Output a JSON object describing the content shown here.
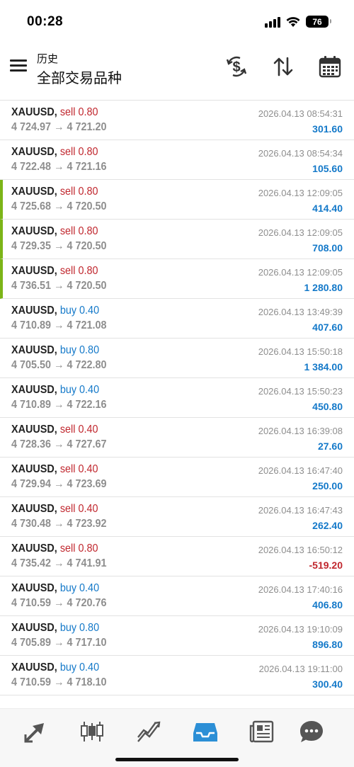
{
  "status_bar": {
    "time": "00:28",
    "battery": "76"
  },
  "header": {
    "title_small": "历史",
    "title_big": "全部交易品种"
  },
  "icons": {
    "menu": "menu-icon",
    "currency": "currency-exchange-icon",
    "sort": "sort-icon",
    "calendar": "calendar-icon"
  },
  "trades": [
    {
      "symbol": "XAUUSD,",
      "type": "sell",
      "volume": "0.80",
      "open": "4 724.97",
      "close": "4 721.20",
      "time": "2026.04.13 08:54:31",
      "profit": "301.60",
      "marked": false
    },
    {
      "symbol": "XAUUSD,",
      "type": "sell",
      "volume": "0.80",
      "open": "4 722.48",
      "close": "4 721.16",
      "time": "2026.04.13 08:54:34",
      "profit": "105.60",
      "marked": false
    },
    {
      "symbol": "XAUUSD,",
      "type": "sell",
      "volume": "0.80",
      "open": "4 725.68",
      "close": "4 720.50",
      "time": "2026.04.13 12:09:05",
      "profit": "414.40",
      "marked": true
    },
    {
      "symbol": "XAUUSD,",
      "type": "sell",
      "volume": "0.80",
      "open": "4 729.35",
      "close": "4 720.50",
      "time": "2026.04.13 12:09:05",
      "profit": "708.00",
      "marked": true
    },
    {
      "symbol": "XAUUSD,",
      "type": "sell",
      "volume": "0.80",
      "open": "4 736.51",
      "close": "4 720.50",
      "time": "2026.04.13 12:09:05",
      "profit": "1 280.80",
      "marked": true
    },
    {
      "symbol": "XAUUSD,",
      "type": "buy",
      "volume": "0.40",
      "open": "4 710.89",
      "close": "4 721.08",
      "time": "2026.04.13 13:49:39",
      "profit": "407.60",
      "marked": false
    },
    {
      "symbol": "XAUUSD,",
      "type": "buy",
      "volume": "0.80",
      "open": "4 705.50",
      "close": "4 722.80",
      "time": "2026.04.13 15:50:18",
      "profit": "1 384.00",
      "marked": false
    },
    {
      "symbol": "XAUUSD,",
      "type": "buy",
      "volume": "0.40",
      "open": "4 710.89",
      "close": "4 722.16",
      "time": "2026.04.13 15:50:23",
      "profit": "450.80",
      "marked": false
    },
    {
      "symbol": "XAUUSD,",
      "type": "sell",
      "volume": "0.40",
      "open": "4 728.36",
      "close": "4 727.67",
      "time": "2026.04.13 16:39:08",
      "profit": "27.60",
      "marked": false
    },
    {
      "symbol": "XAUUSD,",
      "type": "sell",
      "volume": "0.40",
      "open": "4 729.94",
      "close": "4 723.69",
      "time": "2026.04.13 16:47:40",
      "profit": "250.00",
      "marked": false
    },
    {
      "symbol": "XAUUSD,",
      "type": "sell",
      "volume": "0.40",
      "open": "4 730.48",
      "close": "4 723.92",
      "time": "2026.04.13 16:47:43",
      "profit": "262.40",
      "marked": false
    },
    {
      "symbol": "XAUUSD,",
      "type": "sell",
      "volume": "0.80",
      "open": "4 735.42",
      "close": "4 741.91",
      "time": "2026.04.13 16:50:12",
      "profit": "-519.20",
      "marked": false
    },
    {
      "symbol": "XAUUSD,",
      "type": "buy",
      "volume": "0.40",
      "open": "4 710.59",
      "close": "4 720.76",
      "time": "2026.04.13 17:40:16",
      "profit": "406.80",
      "marked": false
    },
    {
      "symbol": "XAUUSD,",
      "type": "buy",
      "volume": "0.80",
      "open": "4 705.89",
      "close": "4 717.10",
      "time": "2026.04.13 19:10:09",
      "profit": "896.80",
      "marked": false
    },
    {
      "symbol": "XAUUSD,",
      "type": "buy",
      "volume": "0.40",
      "open": "4 710.59",
      "close": "4 718.10",
      "time": "2026.04.13 19:11:00",
      "profit": "300.40",
      "marked": false
    }
  ],
  "arrow": "→",
  "bottom_nav": [
    {
      "name": "trade-nav",
      "icon": "trade-arrows-icon",
      "active": false
    },
    {
      "name": "chart-nav",
      "icon": "candlestick-icon",
      "active": false
    },
    {
      "name": "trend-nav",
      "icon": "trend-lines-icon",
      "active": false
    },
    {
      "name": "history-nav",
      "icon": "inbox-tray-icon",
      "active": true
    },
    {
      "name": "news-nav",
      "icon": "newspaper-icon",
      "active": false
    },
    {
      "name": "chat-nav",
      "icon": "chat-bubble-icon",
      "active": false
    }
  ],
  "colors": {
    "sell": "#c0262d",
    "buy": "#1479c9",
    "profit": "#1479c9",
    "loss": "#c0262d",
    "marker": "#7cb518",
    "active_nav": "#2c8fd6",
    "nav_icon": "#555555"
  }
}
